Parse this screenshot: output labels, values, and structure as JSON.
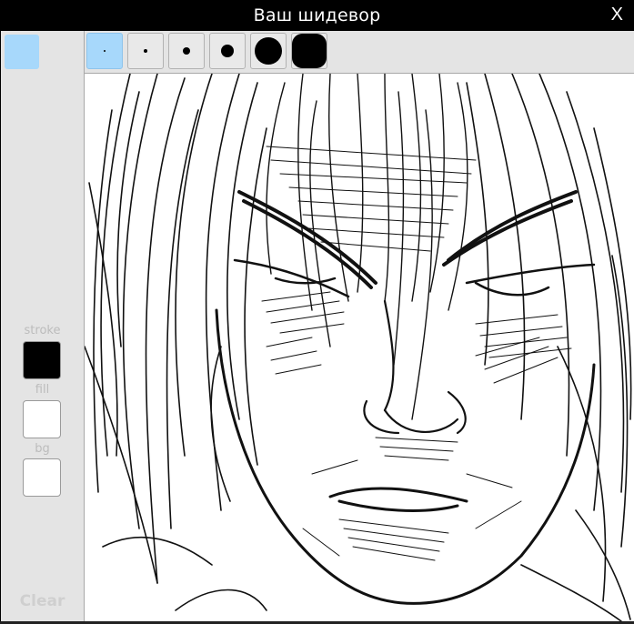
{
  "window": {
    "title": "Ваш шидевор",
    "close_label": "X"
  },
  "sidebar": {
    "active_tool_color": "#a7d8fb",
    "stroke_label": "stroke",
    "fill_label": "fill",
    "bg_label": "bg",
    "stroke_color": "#000000",
    "fill_color": "#ffffff",
    "bg_color": "#ffffff",
    "clear_label": "Clear"
  },
  "toolbar": {
    "brush_sizes": [
      "extra-small",
      "small",
      "medium",
      "large",
      "extra-large",
      "huge"
    ],
    "selected_brush": "extra-small"
  },
  "canvas": {
    "content": "pen sketch of a long-haired man's face"
  }
}
